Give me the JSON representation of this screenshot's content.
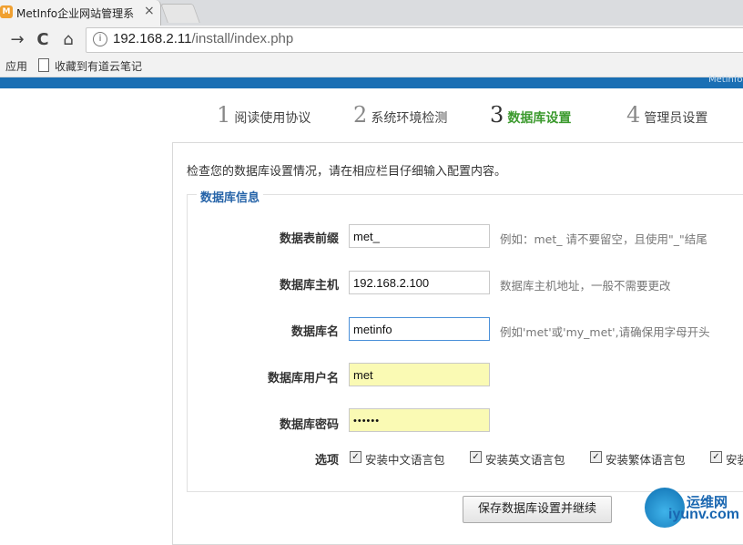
{
  "browser": {
    "tab_title": "MetInfo企业网站管理系",
    "tab_close": "×",
    "favicon_glyph": "M",
    "url_host": "192.168.2.11",
    "url_path": "/install/index.php",
    "bookmarks_apps": "应用",
    "bookmark_1": "收藏到有道云笔记",
    "brand_strip_text": "Metinfo",
    "back_glyph": "→",
    "reload_glyph": "C",
    "home_glyph": "⌂",
    "info_glyph": "i"
  },
  "steps": [
    {
      "num": "1",
      "label": "阅读使用协议",
      "active": false
    },
    {
      "num": "2",
      "label": "系统环境检测",
      "active": false
    },
    {
      "num": "3",
      "label": "数据库设置",
      "active": true
    },
    {
      "num": "4",
      "label": "管理员设置",
      "active": false
    }
  ],
  "form": {
    "intro": "检查您的数据库设置情况，请在相应栏目仔细输入配置内容。",
    "legend": "数据库信息",
    "fields": [
      {
        "label": "数据表前缀",
        "value": "met_",
        "hint": "例如：met_ 请不要留空，且使用\"_\"结尾"
      },
      {
        "label": "数据库主机",
        "value": "192.168.2.100",
        "hint": "数据库主机地址，一般不需要更改"
      },
      {
        "label": "数据库名",
        "value": "metinfo",
        "hint": "例如'met'或'my_met',请确保用字母开头"
      },
      {
        "label": "数据库用户名",
        "value": "met",
        "hint": ""
      },
      {
        "label": "数据库密码",
        "value": "••••••",
        "hint": ""
      }
    ],
    "options_label": "选项",
    "options": [
      {
        "label": "安装中文语言包",
        "checked": true
      },
      {
        "label": "安装英文语言包",
        "checked": true
      },
      {
        "label": "安装繁体语言包",
        "checked": true
      },
      {
        "label": "安装",
        "checked": true
      }
    ],
    "submit": "保存数据库设置并继续"
  },
  "watermark": {
    "top": "运维网",
    "bottom": "iyunv.com"
  },
  "colors": {
    "active_step": "#3c9a2e",
    "legend": "#2563a8",
    "brand_bar": "#1a6fb4",
    "autofill": "#fafab4"
  }
}
